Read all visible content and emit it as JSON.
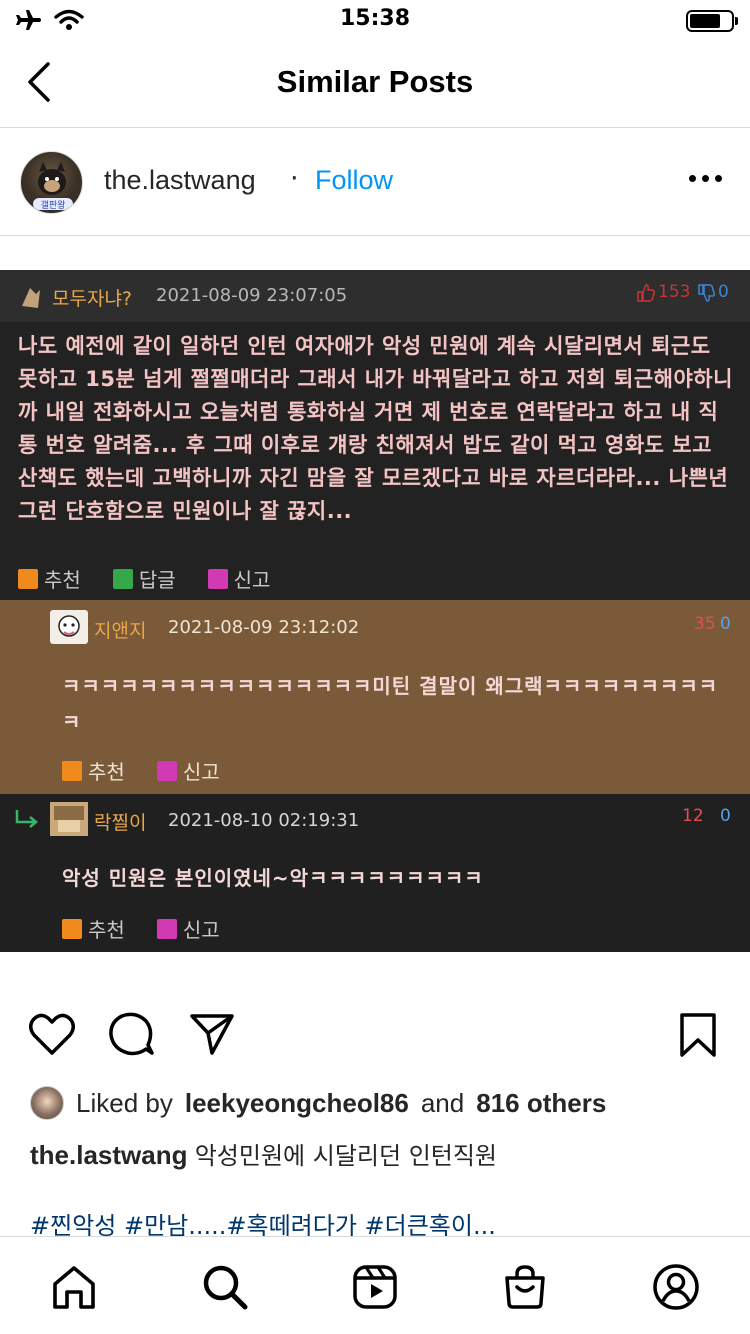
{
  "status_bar": {
    "time": "15:38"
  },
  "header": {
    "title": "Similar Posts"
  },
  "author": {
    "username": "the.lastwang",
    "separator": "·",
    "follow_label": "Follow",
    "avatar_badge_text": "갤판왕"
  },
  "post_image": {
    "main_comment": {
      "user": "모두자냐?",
      "date": "2021-08-09 23:07:05",
      "up_votes": "153",
      "down_votes": "0",
      "text": "나도 예전에 같이 일하던 인턴 여자애가 악성 민원에 계속 시달리면서 퇴근도 못하고 15분 넘게 쩔쩔매더라 그래서 내가 바꿔달라고 하고 저희 퇴근해야하니까 내일 전화하시고 오늘처럼 통화하실 거면 제 번호로 연락달라고 하고 내 직통 번호 알려줌... 후 그때 이후로 걔랑 친해져서 밥도 같이 먹고 영화도 보고 산책도 했는데 고백하니까 자긴 맘을 잘 모르겠다고 바로 자르더라라... 나쁜년 그런 단호함으로 민원이나 잘 끊지...",
      "actions": [
        "추천",
        "답글",
        "신고"
      ]
    },
    "reply1": {
      "user": "지앤지",
      "date": "2021-08-09 23:12:02",
      "up_votes": "35",
      "down_votes": "0",
      "text_line1": "ㅋㅋㅋㅋㅋㅋㅋㅋㅋㅋㅋㅋㅋㅋㅋㅋ미틴 결말이 왜그랙ㅋㅋㅋㅋㅋㅋㅋㅋㅋ",
      "text_line2": "ㅋ",
      "actions": [
        "추천",
        "신고"
      ]
    },
    "reply2": {
      "user": "락찔이",
      "date": "2021-08-10 02:19:31",
      "up_votes": "12",
      "down_votes": "0",
      "text": "악성 민원은 본인이였네~악ㅋㅋㅋㅋㅋㅋㅋㅋㅋ",
      "actions": [
        "추천",
        "신고"
      ]
    }
  },
  "likes": {
    "prefix": "Liked by",
    "user": "leekyeongcheol86",
    "and": "and",
    "others": "816 others"
  },
  "caption": {
    "username": "the.lastwang",
    "text": "악성민원에 시달리던 인턴직원"
  },
  "hashtags": "#찐악성 #만남.....#혹떼려다가 #더큰혹이...",
  "icons": {
    "status_left": [
      "airplane-icon",
      "wifi-icon"
    ],
    "status_right": "battery-icon",
    "actions": [
      "heart-icon",
      "comment-icon",
      "share-icon",
      "bookmark-icon"
    ],
    "nav": [
      "home-icon",
      "search-icon",
      "reels-icon",
      "shop-icon",
      "profile-icon"
    ]
  }
}
